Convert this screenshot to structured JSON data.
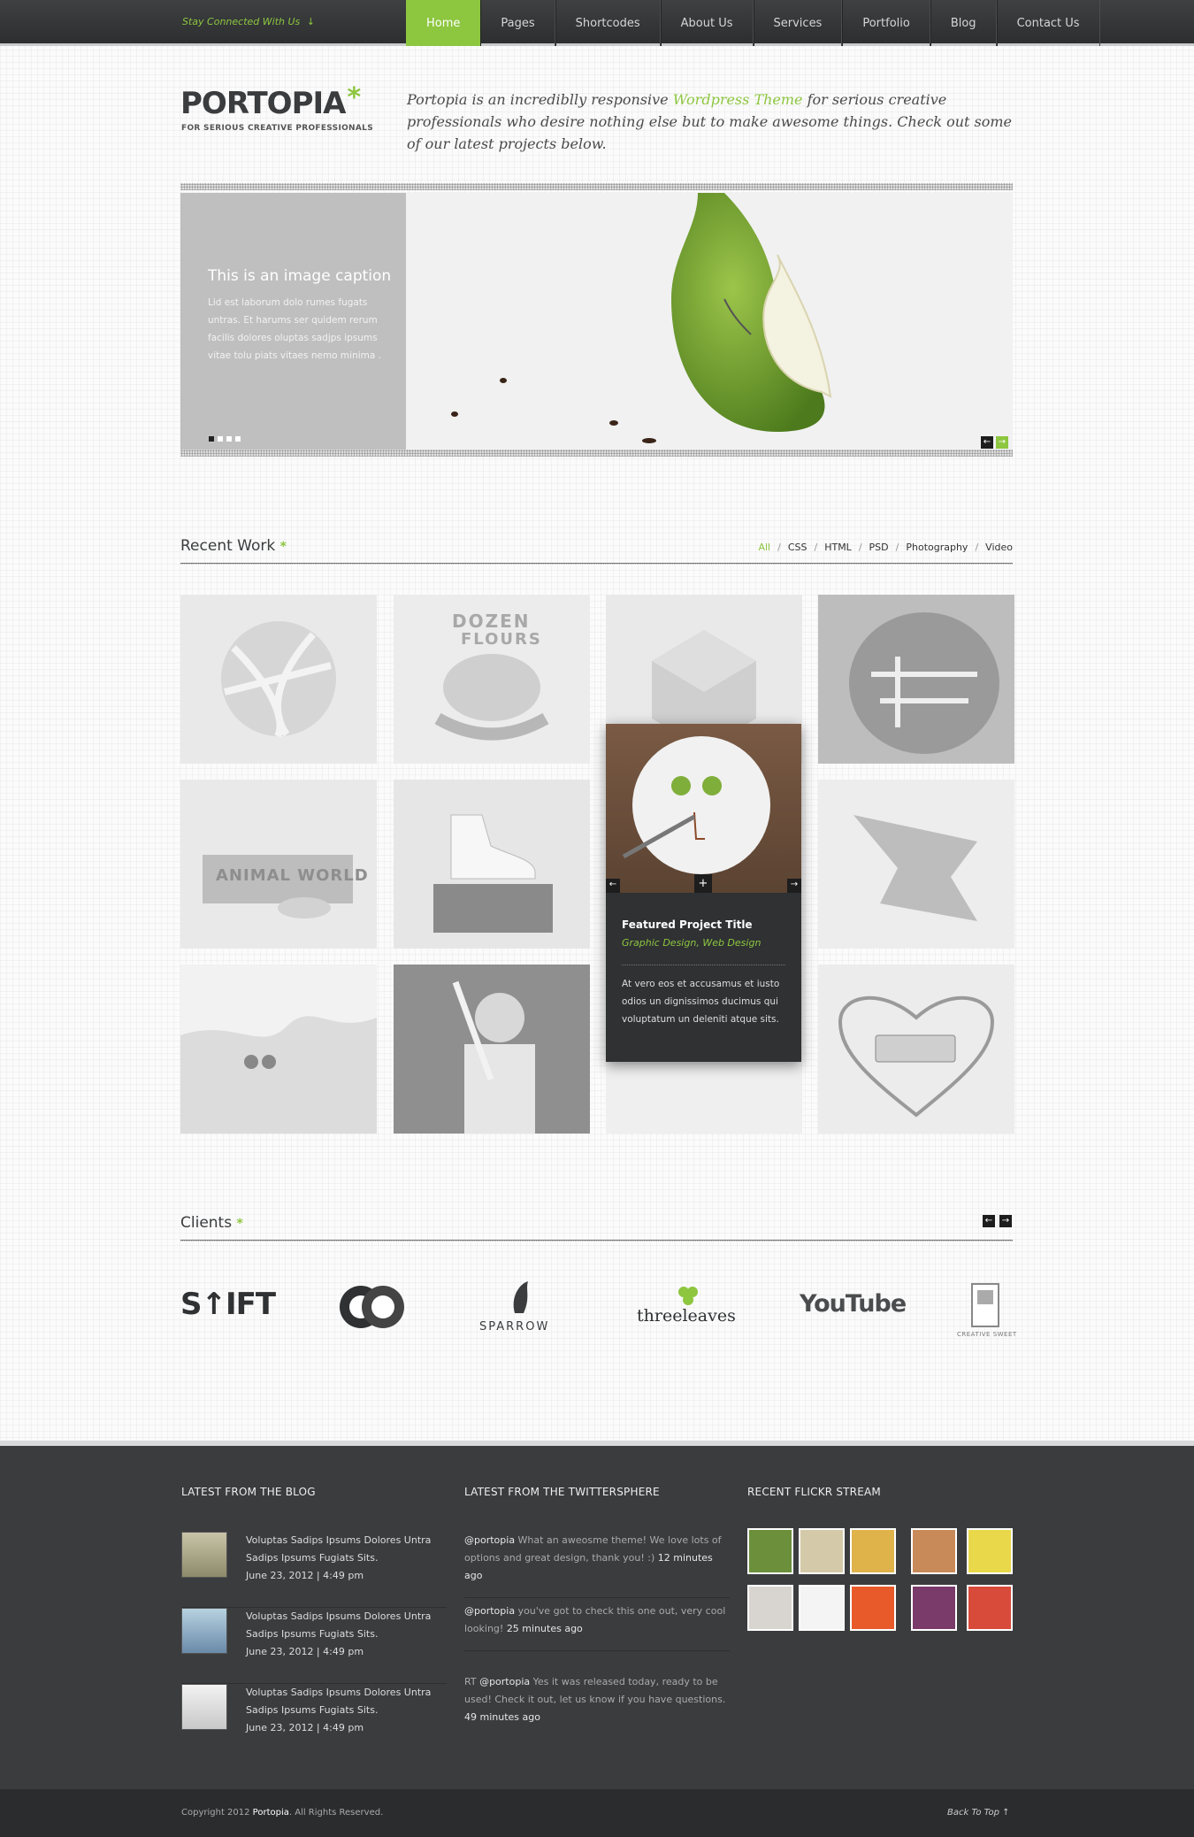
{
  "topbar": {
    "tagline": "Stay Connected With Us",
    "tagline_arrow": "↓",
    "nav": [
      {
        "label": "Home",
        "active": true
      },
      {
        "label": "Pages"
      },
      {
        "label": "Shortcodes"
      },
      {
        "label": "About Us"
      },
      {
        "label": "Services"
      },
      {
        "label": "Portfolio"
      },
      {
        "label": "Blog"
      },
      {
        "label": "Contact Us"
      }
    ]
  },
  "header": {
    "logo": "PORTOPIA",
    "logo_mark": "*",
    "logo_sub": "FOR SERIOUS CREATIVE PROFESSIONALS",
    "intro_before": "Portopia is an incrediblly responsive ",
    "intro_link": "Wordpress Theme",
    "intro_after": " for serious creative professionals who desire nothing else but to make awesome things. Check out some of our latest projects below."
  },
  "slider": {
    "caption_title": "This is an image caption",
    "caption_text": "Lid est laborum dolo rumes fugats untras. Et harums ser quidem rerum facilis dolores oluptas sadjps ipsums vitae tolu piats vitaes nemo minima .",
    "prev": "←",
    "next": "→"
  },
  "recent": {
    "title": "Recent Work",
    "mark": "*",
    "filters": [
      "All",
      "CSS",
      "HTML",
      "PSD",
      "Photography",
      "Video"
    ],
    "active_filter": "All",
    "featured": {
      "title": "Featured Project Title",
      "categories": "Graphic Design, Web Design",
      "text": "At vero eos et accusamus et iusto odios un  dignissimos ducimus qui voluptatum un deleniti atque sits.",
      "prev": "←",
      "next": "→",
      "plus": "+"
    },
    "tiles": [
      "DOZEN",
      "FLOURS",
      "ANIMAL WORLD"
    ]
  },
  "clients": {
    "title": "Clients",
    "mark": "*",
    "prev": "←",
    "next": "→",
    "logos": [
      "S↑IFT",
      "OC",
      "SPARROW",
      "threeleaves",
      "YouTube",
      "CREATIVE SWEET"
    ]
  },
  "footer": {
    "blog_title": "LATEST FROM THE BLOG",
    "twitter_title": "LATEST FROM THE TWITTERSPHERE",
    "flickr_title": "RECENT FLICKR STREAM",
    "posts": [
      {
        "title": "Voluptas Sadips Ipsums Dolores Untra Sadips Ipsums Fugiats Sits.",
        "date": "June 23, 2012   |   4:49 pm"
      },
      {
        "title": "Voluptas Sadips Ipsums Dolores Untra Sadips Ipsums Fugiats Sits.",
        "date": "June 23, 2012   |   4:49 pm"
      },
      {
        "title": "Voluptas Sadips Ipsums Dolores Untra Sadips Ipsums Fugiats Sits.",
        "date": "June 23, 2012   |   4:49 pm"
      }
    ],
    "tweets": [
      {
        "pre": "",
        "handle": "@portopia",
        "text": " What an aweosme theme!  We love lots of options and great design, thank you!  :) ",
        "time": "12 minutes ago"
      },
      {
        "pre": "",
        "handle": "@portopia",
        "text": " you've got to check this one out, very cool looking! ",
        "time": "25 minutes ago"
      },
      {
        "pre": "RT ",
        "handle": "@portopia",
        "text": " Yes it was released today, ready to be used! Check it out, let us know if you have questions. ",
        "time": "49 minutes ago"
      }
    ],
    "flickr_colors": [
      "#6b8f3a",
      "#d4c9a8",
      "#e0b24a",
      "#c98a5a",
      "#e8d84a",
      "#d8d4d0",
      "#f4f4f4",
      "#e85a2a",
      "#7a3a6a",
      "#d84a3a"
    ],
    "copyright_before": "Copyright 2012 ",
    "copyright_brand": "Portopia",
    "copyright_after": ".  All Rights Reserved.",
    "back_to_top": "Back To Top",
    "back_arrow": "↑"
  },
  "colors": {
    "accent": "#8dc63f",
    "dark": "#3a3c3e"
  }
}
